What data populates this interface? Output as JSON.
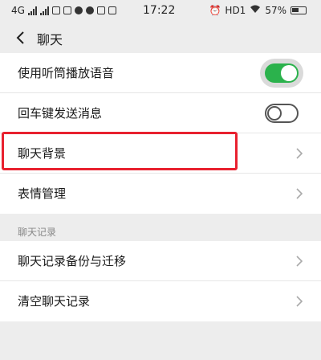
{
  "status_bar": {
    "network": "4G",
    "time": "17:22",
    "network_right": "HD1",
    "battery": "57%"
  },
  "header": {
    "title": "聊天"
  },
  "settings": {
    "earpiece_label": "使用听筒播放语音",
    "earpiece_on": true,
    "enter_send_label": "回车键发送消息",
    "enter_send_on": false,
    "background_label": "聊天背景",
    "emoji_label": "表情管理"
  },
  "history": {
    "section_title": "聊天记录",
    "backup_label": "聊天记录备份与迁移",
    "clear_label": "清空聊天记录"
  },
  "colors": {
    "toggle_on": "#2bb24c",
    "highlight": "#e8212f"
  }
}
